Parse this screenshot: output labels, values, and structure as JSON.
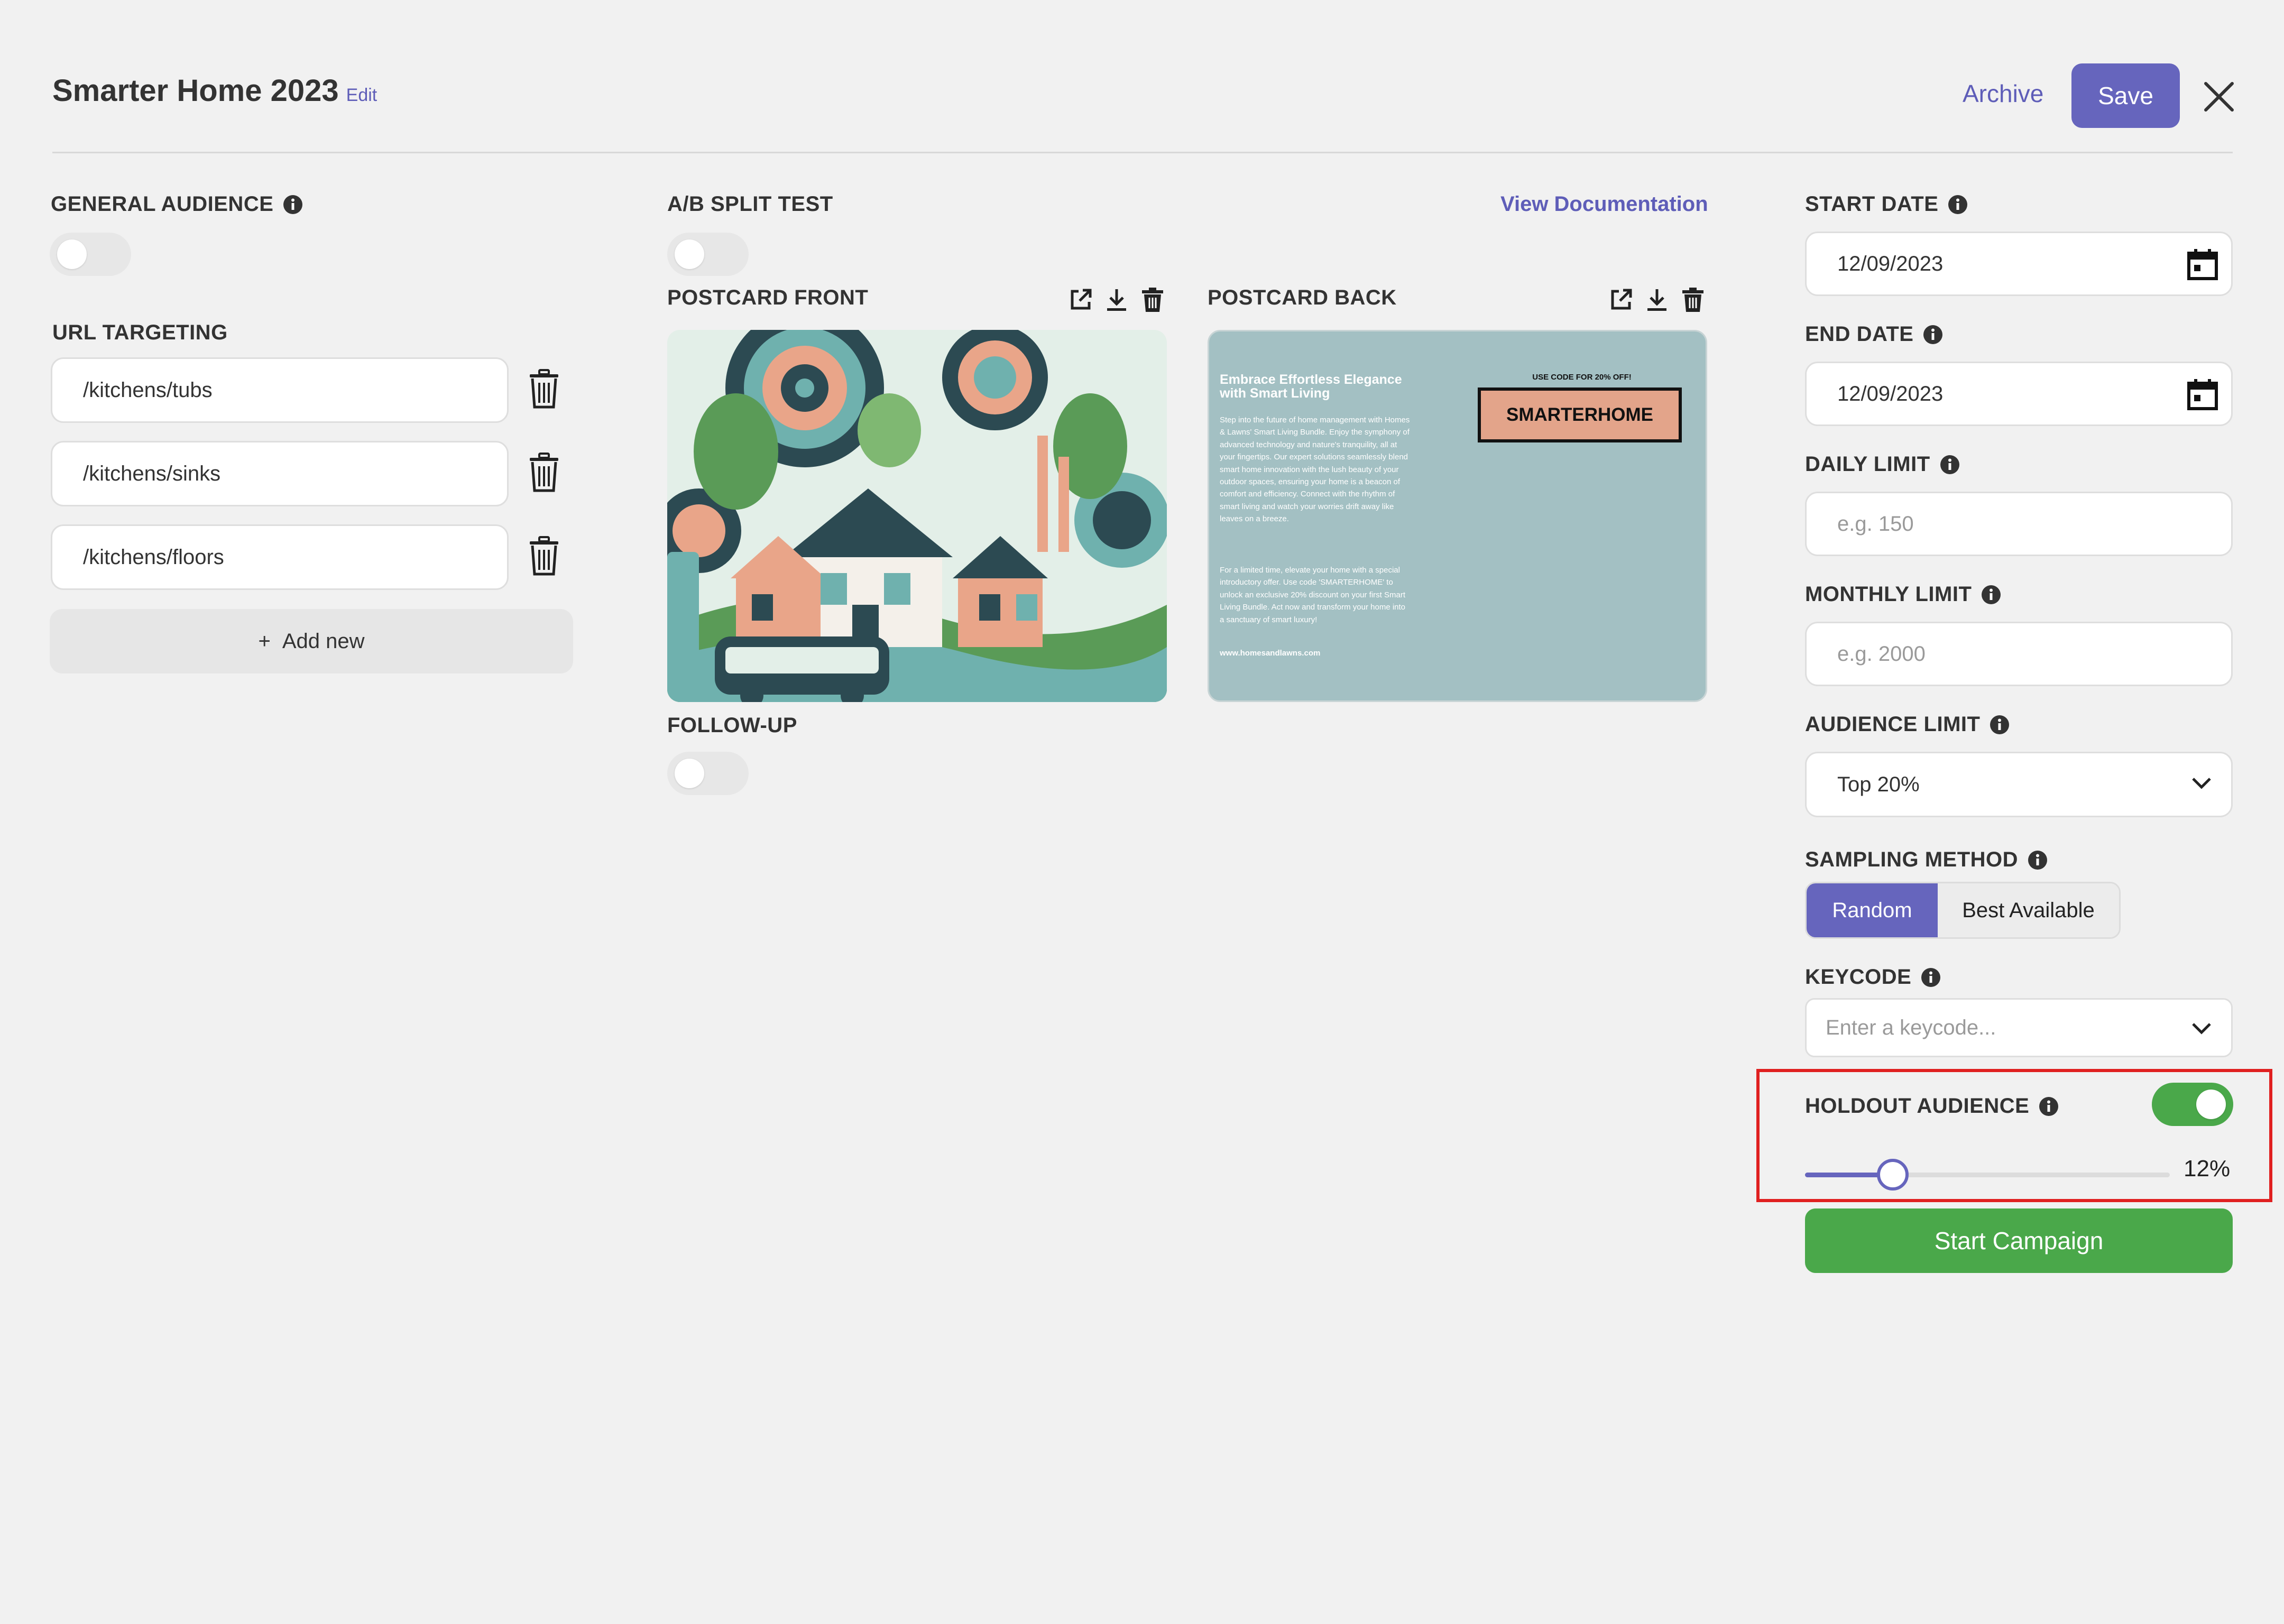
{
  "header": {
    "title": "Smarter Home 2023",
    "edit_label": "Edit",
    "archive_label": "Archive",
    "save_label": "Save"
  },
  "left": {
    "general_audience_label": "GENERAL AUDIENCE",
    "general_audience_on": false,
    "url_targeting_label": "URL TARGETING",
    "urls": [
      "/kitchens/tubs",
      "/kitchens/sinks",
      "/kitchens/floors"
    ],
    "add_new_label": "Add new"
  },
  "middle": {
    "ab_split_label": "A/B SPLIT TEST",
    "ab_split_on": false,
    "view_docs_label": "View Documentation",
    "postcard_front_label": "POSTCARD FRONT",
    "postcard_back_label": "POSTCARD BACK",
    "follow_up_label": "FOLLOW-UP",
    "follow_up_on": false,
    "back": {
      "heading": "Embrace Effortless Elegance with Smart Living",
      "body1": "Step into the future of home management with Homes & Lawns' Smart Living Bundle. Enjoy the symphony of advanced technology and nature's tranquility, all at your fingertips. Our expert solutions seamlessly blend smart home innovation with the lush beauty of your outdoor spaces, ensuring your home is a beacon of comfort and efficiency. Connect with the rhythm of smart living and watch your worries drift away like leaves on a breeze.",
      "body2": "For a limited time, elevate your home with a special introductory offer. Use code 'SMARTERHOME' to unlock an exclusive 20% discount on your first Smart Living Bundle. Act now and transform your home into a sanctuary of smart luxury!",
      "url": "www.homesandlawns.com",
      "code_caption": "USE CODE FOR 20% OFF!",
      "code": "SMARTERHOME"
    }
  },
  "right": {
    "start_date_label": "START DATE",
    "start_date": "12/09/2023",
    "end_date_label": "END DATE",
    "end_date": "12/09/2023",
    "daily_limit_label": "DAILY LIMIT",
    "daily_limit_placeholder": "e.g. 150",
    "monthly_limit_label": "MONTHLY LIMIT",
    "monthly_limit_placeholder": "e.g. 2000",
    "audience_limit_label": "AUDIENCE LIMIT",
    "audience_limit_value": "Top 20%",
    "sampling_label": "SAMPLING METHOD",
    "sampling_options": [
      "Random",
      "Best Available"
    ],
    "sampling_selected": "Random",
    "keycode_label": "KEYCODE",
    "keycode_placeholder": "Enter a keycode...",
    "holdout_label": "HOLDOUT AUDIENCE",
    "holdout_on": true,
    "holdout_percent_text": "12%",
    "holdout_value": 0.12,
    "start_campaign_label": "Start Campaign"
  },
  "colors": {
    "accent": "#6665bd",
    "success": "#4aa84a",
    "highlight": "#e02020",
    "postcard_back_bg": "#a3c0c3",
    "code_box": "#e3a48a"
  }
}
